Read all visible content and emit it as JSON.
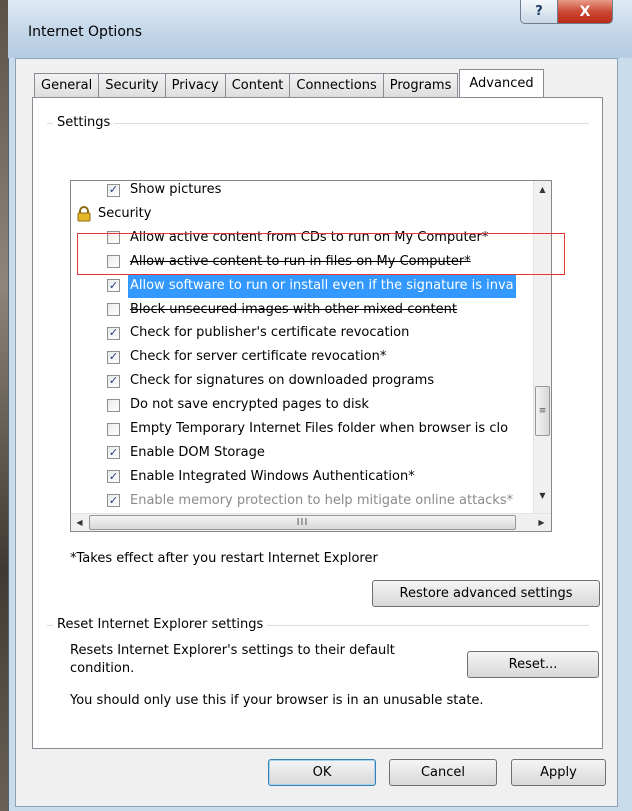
{
  "window": {
    "title": "Internet Options",
    "help_label": "?",
    "close_label": "X"
  },
  "tabs": [
    {
      "label": "General"
    },
    {
      "label": "Security"
    },
    {
      "label": "Privacy"
    },
    {
      "label": "Content"
    },
    {
      "label": "Connections"
    },
    {
      "label": "Programs"
    },
    {
      "label": "Advanced",
      "active": true
    }
  ],
  "settings_group": {
    "label": "Settings",
    "items": [
      {
        "text": "Show pictures",
        "checked": true
      },
      {
        "text": "Security",
        "category": true
      },
      {
        "text": "Allow active content from CDs to run on My Computer*",
        "checked": false
      },
      {
        "text": "Allow active content to run in files on My Computer*",
        "checked": false
      },
      {
        "text": "Allow software to run or install even if the signature is inva",
        "checked": true,
        "selected": true
      },
      {
        "text": "Block unsecured images with other mixed content",
        "checked": false
      },
      {
        "text": "Check for publisher's certificate revocation",
        "checked": true
      },
      {
        "text": "Check for server certificate revocation*",
        "checked": true
      },
      {
        "text": "Check for signatures on downloaded programs",
        "checked": true
      },
      {
        "text": "Do not save encrypted pages to disk",
        "checked": false
      },
      {
        "text": "Empty Temporary Internet Files folder when browser is clo",
        "checked": false
      },
      {
        "text": "Enable DOM Storage",
        "checked": true
      },
      {
        "text": "Enable Integrated Windows Authentication*",
        "checked": true
      },
      {
        "text": "Enable memory protection to help mitigate online attacks*",
        "checked": true
      }
    ],
    "footnote": "*Takes effect after you restart Internet Explorer",
    "restore_label": "Restore advanced settings"
  },
  "reset_group": {
    "label": "Reset Internet Explorer settings",
    "description_line1": "Resets Internet Explorer's settings to their default",
    "description_line2": "condition.",
    "reset_label": "Reset...",
    "warning": "You should only use this if your browser is in an unusable state."
  },
  "buttons": {
    "ok": "OK",
    "cancel": "Cancel",
    "apply": "Apply"
  },
  "scrollbar_glyphs": {
    "up": "▲",
    "down": "▼",
    "left": "◀",
    "right": "▶",
    "vthumb": "≡",
    "hthumb": "III"
  },
  "colors": {
    "selection": "#3399ff",
    "highlight_box": "#e53935",
    "checkmark": "#1c3e7a"
  }
}
